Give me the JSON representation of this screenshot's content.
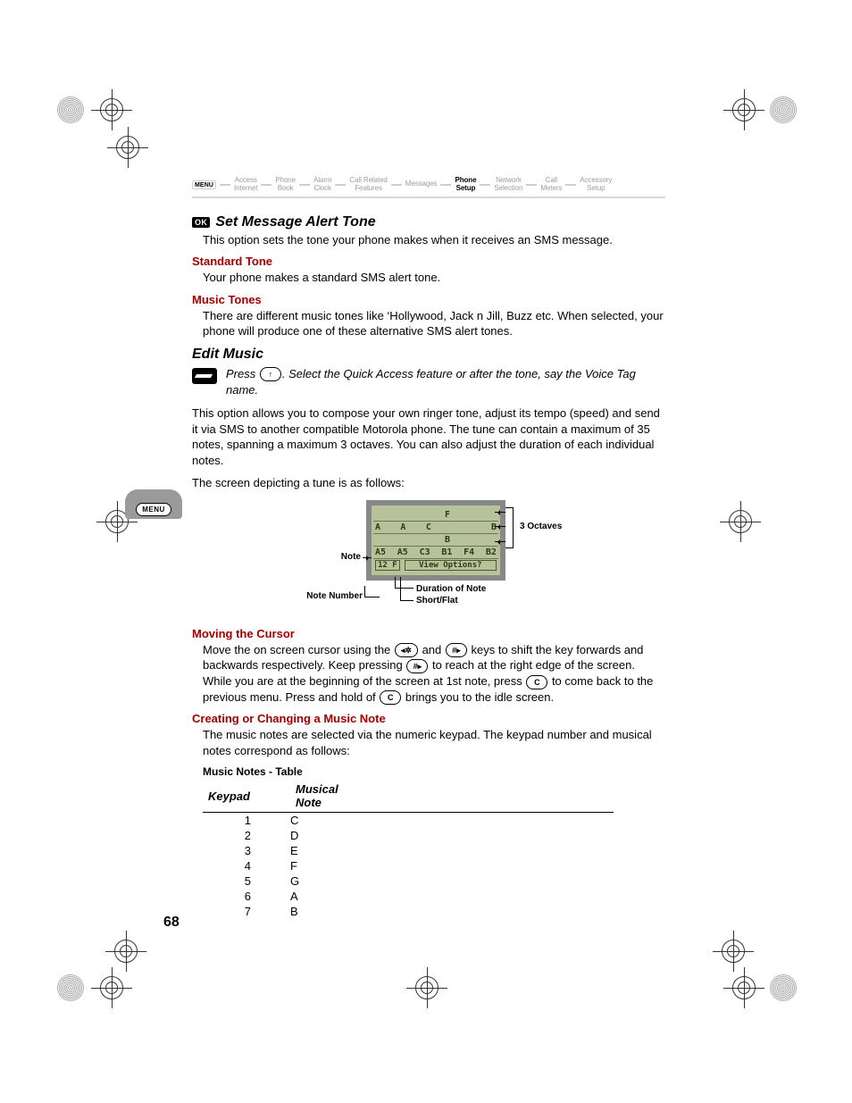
{
  "breadcrumb": {
    "menu": "MENU",
    "items": [
      "Access\nInternet",
      "Phone\nBook",
      "Alarm\nClock",
      "Call Related\nFeatures",
      "Messages",
      "Phone\nSetup",
      "Network\nSelection",
      "Call\nMeters",
      "Accessory\nSetup"
    ],
    "bold_index": 5
  },
  "ok_badge": "OK",
  "section1": {
    "title": "Set Message Alert Tone",
    "intro": "This option sets the tone your phone makes when it receives an SMS message.",
    "sub1_title": "Standard Tone",
    "sub1_body": "Your phone makes a standard SMS alert tone.",
    "sub2_title": "Music Tones",
    "sub2_body": "There are different music tones like ‘Hollywood, Jack n Jill, Buzz etc. When selected, your phone will produce one of these alternative SMS alert tones."
  },
  "section2": {
    "title": "Edit Music",
    "quick_pre": "Press ",
    "quick_key": "↑",
    "quick_post": ". Select the Quick Access feature or after the tone, say the Voice Tag name.",
    "para1": "This option allows you to compose your own ringer tone, adjust its tempo (speed) and send it via SMS to another compatible Motorola phone. The tune can contain a maximum of 35 notes, spanning a maximum 3 octaves. You can also adjust the duration of each individual notes.",
    "para2": "The screen depicting a tune is as follows:"
  },
  "figure": {
    "row1": [
      "",
      "",
      "",
      "F",
      "",
      ""
    ],
    "row2": [
      "A",
      "A",
      "C",
      "",
      "",
      "B"
    ],
    "row3": [
      "",
      "",
      "",
      "B",
      "",
      ""
    ],
    "row4": [
      "A5",
      "A5",
      "C3",
      "B1",
      "F4",
      "B2"
    ],
    "bottom_left": "12 F",
    "bottom_right": "View Options?",
    "label_octaves": "3 Octaves",
    "label_note": "Note",
    "label_notenum": "Note Number",
    "label_duration": "Duration of Note",
    "label_shortflat": "Short/Flat"
  },
  "moving": {
    "title": "Moving the Cursor",
    "l1a": "Move the on screen cursor using the ",
    "k1": "◂✲",
    "l1b": " and ",
    "k2": "#▸",
    "l1c": " keys to shift the key forwards and backwards respectively. Keep pressing ",
    "k3": "#▸",
    "l1d": " to reach at the right edge of the screen. While you are at the beginning of the screen at 1st note, press ",
    "k4": "C",
    "l1e": " to come back to the previous menu. Press and hold of ",
    "k5": "C",
    "l1f": " brings you to the idle screen."
  },
  "creating": {
    "title": "Creating or Changing a Music Note",
    "body": "The music notes are selected via the numeric keypad. The keypad number and musical notes correspond as follows:"
  },
  "table": {
    "title": "Music Notes - Table",
    "head_key": "Keypad",
    "head_note": "Musical Note",
    "rows": [
      {
        "k": "1",
        "n": "C"
      },
      {
        "k": "2",
        "n": "D"
      },
      {
        "k": "3",
        "n": "E"
      },
      {
        "k": "4",
        "n": "F"
      },
      {
        "k": "5",
        "n": "G"
      },
      {
        "k": "6",
        "n": "A"
      },
      {
        "k": "7",
        "n": "B"
      }
    ]
  },
  "menu_pill": "MENU",
  "page_number": "68"
}
